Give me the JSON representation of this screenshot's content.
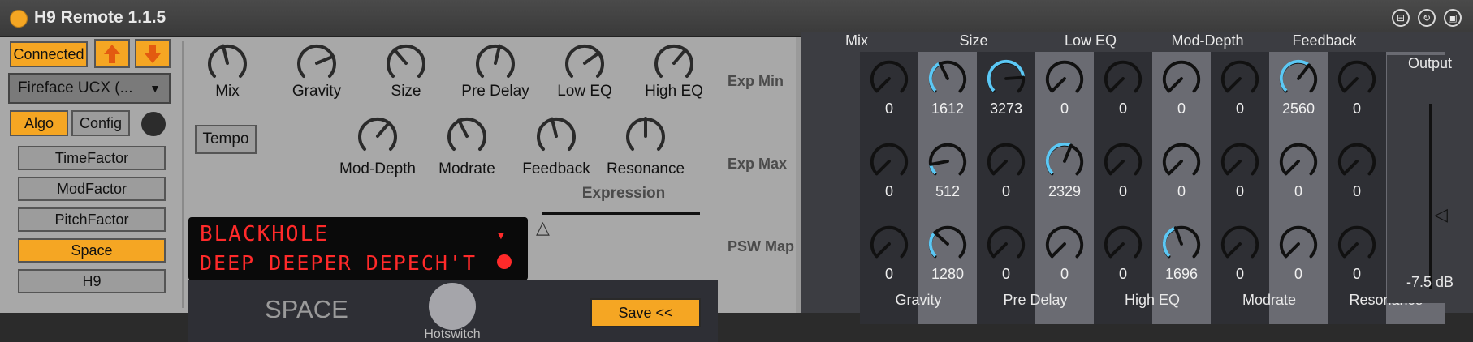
{
  "window": {
    "title": "H9 Remote 1.1.5",
    "titlebar_buttons": [
      "pin-icon",
      "refresh-icon",
      "save-icon"
    ]
  },
  "device": {
    "connection_status": "Connected",
    "arrow_up_icon": "arrow-up-icon",
    "arrow_down_icon": "arrow-down-icon",
    "interface_select": "Fireface UCX (..."
  },
  "mode_tabs": {
    "algo": "Algo",
    "config": "Config"
  },
  "factor_buttons": [
    "TimeFactor",
    "ModFactor",
    "PitchFactor",
    "Space",
    "H9"
  ],
  "active_factor": "Space",
  "knobs_row1": [
    "Mix",
    "Gravity",
    "Size",
    "Pre Delay",
    "Low EQ",
    "High EQ"
  ],
  "knobs_row2": [
    "Mod-Depth",
    "Modrate",
    "Feedback",
    "Resonance"
  ],
  "tempo_button": "Tempo",
  "preset_display": {
    "line1": "BLACKHOLE",
    "line2": "DEEP DEEPER DEPECH'T"
  },
  "expression": {
    "label": "Expression"
  },
  "algorithm_name": "SPACE",
  "hotswitch_label": "Hotswitch",
  "save_button": "Save <<",
  "mapping": {
    "top_headers": [
      "Mix",
      "Size",
      "Low EQ",
      "Mod-Depth",
      "Feedback"
    ],
    "bottom_headers": [
      "Gravity",
      "Pre Delay",
      "High EQ",
      "Modrate",
      "Resonance"
    ],
    "row_labels": [
      "Exp Min",
      "Exp Max",
      "PSW Map"
    ],
    "rows": [
      [
        "0",
        "1612",
        "3273",
        "0",
        "0",
        "0",
        "0",
        "2560",
        "0",
        "0"
      ],
      [
        "0",
        "512",
        "0",
        "2329",
        "0",
        "0",
        "0",
        "0",
        "0",
        "0"
      ],
      [
        "0",
        "1280",
        "0",
        "0",
        "0",
        "1696",
        "0",
        "0",
        "0",
        "0"
      ]
    ]
  },
  "output": {
    "label": "Output",
    "level": "-7.5 dB"
  },
  "colors": {
    "accent": "#f5a623",
    "lcd": "#ff2a2a",
    "knob_active": "#5bc8f5"
  }
}
